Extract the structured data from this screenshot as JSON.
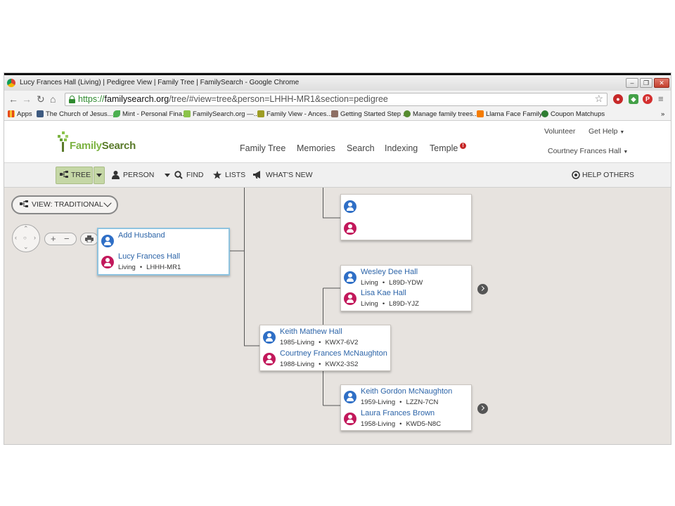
{
  "browser": {
    "window_title": "Lucy Frances Hall (Living) | Pedigree View | Family Tree | FamilySearch - Google Chrome",
    "url_scheme": "https://",
    "url_host": "familysearch.org",
    "url_path": "/tree/#view=tree&person=LHHH-MR1&section=pedigree",
    "bookmarks": [
      {
        "label": "Apps",
        "color": "#e64a19"
      },
      {
        "label": "The Church of Jesus...",
        "color": "#3d5a80"
      },
      {
        "label": "Mint - Personal Fina...",
        "color": "#4caf50"
      },
      {
        "label": "FamilySearch.org —...",
        "color": "#8bc34a"
      },
      {
        "label": "Family View - Ances...",
        "color": "#9e9d24"
      },
      {
        "label": "Getting Started Step ...",
        "color": "#8d6e63"
      },
      {
        "label": "Manage family trees...",
        "color": "#558b2f"
      },
      {
        "label": "Llama Face Family",
        "color": "#f57c00"
      },
      {
        "label": "Coupon Matchups",
        "color": "#2e7d32"
      }
    ]
  },
  "header": {
    "logo_part1": "Family",
    "logo_part2": "Search",
    "nav": [
      "Family Tree",
      "Memories",
      "Search",
      "Indexing",
      "Temple"
    ],
    "volunteer": "Volunteer",
    "get_help": "Get Help",
    "user": "Courtney Frances Hall"
  },
  "toolbar": {
    "tree": "TREE",
    "person": "PERSON",
    "find": "FIND",
    "lists": "LISTS",
    "whats_new": "WHAT'S NEW",
    "help_others": "HELP OTHERS"
  },
  "view": {
    "label": "VIEW: TRADITIONAL"
  },
  "tree": {
    "root": {
      "husband": {
        "name": "Add Husband"
      },
      "wife": {
        "name": "Lucy Frances Hall",
        "info": "Living",
        "id": "LHHH-MR1"
      }
    },
    "top_parents": {
      "father": {
        "name": ""
      },
      "mother": {
        "name": ""
      }
    },
    "parents": {
      "father": {
        "name": "Keith Mathew Hall",
        "info": "1985-Living",
        "id": "KWX7-6V2"
      },
      "mother": {
        "name": "Courtney Frances McNaughton",
        "info": "1988-Living",
        "id": "KWX2-3S2"
      }
    },
    "paternal": {
      "father": {
        "name": "Wesley Dee Hall",
        "info": "Living",
        "id": "L89D-YDW"
      },
      "mother": {
        "name": "Lisa Kae Hall",
        "info": "Living",
        "id": "L89D-YJZ"
      }
    },
    "maternal": {
      "father": {
        "name": "Keith Gordon McNaughton",
        "info": "1959-Living",
        "id": "LZZN-7CN"
      },
      "mother": {
        "name": "Laura Frances Brown",
        "info": "1958-Living",
        "id": "KWD5-N8C"
      }
    }
  }
}
